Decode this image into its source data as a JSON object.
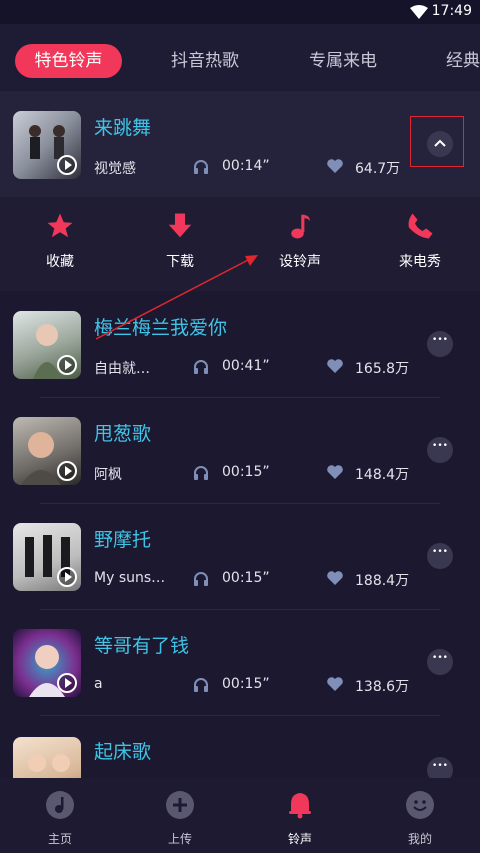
{
  "status": {
    "time": "17:49"
  },
  "tabs": [
    {
      "label": "特色铃声",
      "active": true
    },
    {
      "label": "抖音热歌"
    },
    {
      "label": "专属来电"
    },
    {
      "label": "经典"
    }
  ],
  "songs": [
    {
      "title": "来跳舞",
      "artist": "视觉感",
      "duration": "00:14”",
      "likes": "64.7万"
    },
    {
      "title": "梅兰梅兰我爱你",
      "artist": "自由就…",
      "duration": "00:41”",
      "likes": "165.8万"
    },
    {
      "title": "甩葱歌",
      "artist": "阿枫",
      "duration": "00:15”",
      "likes": "148.4万"
    },
    {
      "title": "野摩托",
      "artist": "My suns…",
      "duration": "00:15”",
      "likes": "188.4万"
    },
    {
      "title": "等哥有了钱",
      "artist": "a",
      "duration": "00:15”",
      "likes": "138.6万"
    },
    {
      "title": "起床歌",
      "artist": "",
      "duration": "",
      "likes": ""
    }
  ],
  "actions": {
    "favorite": "收藏",
    "download": "下载",
    "set_ringtone": "设铃声",
    "caller_show": "来电秀"
  },
  "nav": {
    "home": "主页",
    "upload": "上传",
    "ringtone": "铃声",
    "mine": "我的"
  },
  "colors": {
    "accent": "#f2385a",
    "title": "#3fc3e6",
    "background": "#1b1830"
  }
}
